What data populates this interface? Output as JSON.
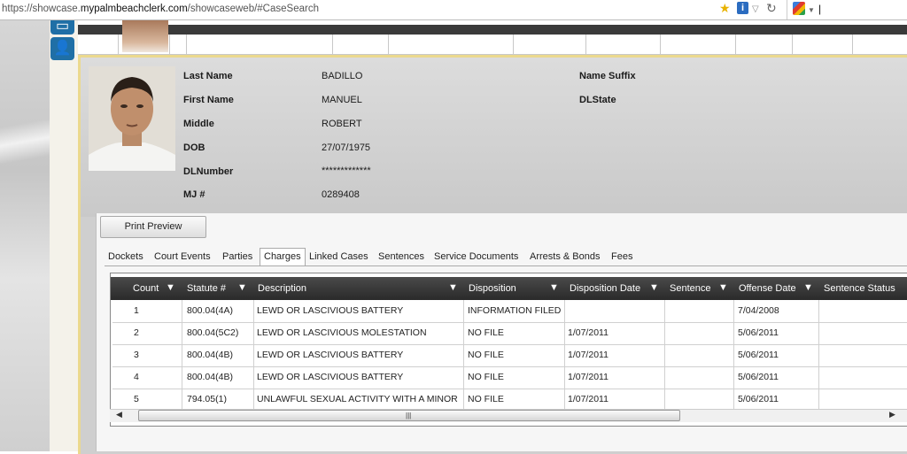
{
  "browser": {
    "url_prefix": "https://showcase.",
    "url_domain": "mypalmbeachclerk.com",
    "url_suffix": "/showcaseweb/#CaseSearch"
  },
  "person": {
    "fields": [
      {
        "label": "Last Name",
        "value": "BADILLO"
      },
      {
        "label": "First Name",
        "value": "MANUEL"
      },
      {
        "label": "Middle",
        "value": "ROBERT"
      },
      {
        "label": "DOB",
        "value": "27/07/1975"
      },
      {
        "label": "DLNumber",
        "value": "*************"
      },
      {
        "label": "MJ #",
        "value": "0289408"
      }
    ],
    "right_fields": [
      {
        "label": "Name Suffix",
        "value": ""
      },
      {
        "label": "DLState",
        "value": ""
      }
    ]
  },
  "toolbar": {
    "print_label": "Print Preview"
  },
  "tabs": [
    "Dockets",
    "Court Events",
    "Parties",
    "Charges",
    "Linked Cases",
    "Sentences",
    "Service Documents",
    "Arrests & Bonds",
    "Fees"
  ],
  "active_tab": "Charges",
  "grid": {
    "columns": [
      "Count",
      "Statute #",
      "Description",
      "Disposition",
      "Disposition Date",
      "Sentence",
      "Offense Date",
      "Sentence Status"
    ],
    "rows": [
      [
        "1",
        "800.04(4A)",
        "LEWD OR LASCIVIOUS BATTERY",
        "INFORMATION FILED",
        "",
        "",
        "7/04/2008",
        ""
      ],
      [
        "2",
        "800.04(5C2)",
        "LEWD OR LASCIVIOUS MOLESTATION",
        "NO FILE",
        "1/07/2011",
        "",
        "5/06/2011",
        ""
      ],
      [
        "3",
        "800.04(4B)",
        "LEWD OR LASCIVIOUS BATTERY",
        "NO FILE",
        "1/07/2011",
        "",
        "5/06/2011",
        ""
      ],
      [
        "4",
        "800.04(4B)",
        "LEWD OR LASCIVIOUS BATTERY",
        "NO FILE",
        "1/07/2011",
        "",
        "5/06/2011",
        ""
      ],
      [
        "5",
        "794.05(1)",
        "UNLAWFUL SEXUAL ACTIVITY WITH A MINOR",
        "NO FILE",
        "1/07/2011",
        "",
        "5/06/2011",
        ""
      ]
    ]
  },
  "colors": {
    "accent": "#1f6fa6",
    "header_dark": "#2a2a2a",
    "panel_border": "#ebd98e"
  }
}
